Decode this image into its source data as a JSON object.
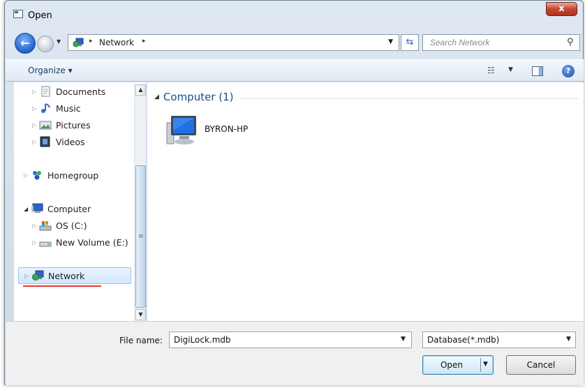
{
  "window": {
    "title": "Open",
    "close_glyph": "x"
  },
  "address": {
    "nav_back_glyph": "←",
    "crumb": "Network",
    "separator": "▸",
    "search_placeholder": "Search Network"
  },
  "toolbar": {
    "organize": "Organize ▾"
  },
  "nav_tree": {
    "items": [
      {
        "label": "Documents",
        "icon": "documents-icon"
      },
      {
        "label": "Music",
        "icon": "music-icon"
      },
      {
        "label": "Pictures",
        "icon": "pictures-icon"
      },
      {
        "label": "Videos",
        "icon": "videos-icon"
      },
      {
        "label": "Homegroup",
        "icon": "homegroup-icon"
      },
      {
        "label": "Computer",
        "icon": "computer-icon"
      },
      {
        "label": "OS (C:)",
        "icon": "drive-c-icon"
      },
      {
        "label": "New Volume (E:)",
        "icon": "drive-e-icon"
      },
      {
        "label": "Network",
        "icon": "network-icon",
        "selected": true
      }
    ]
  },
  "content": {
    "group_title": "Computer (1)",
    "items": [
      {
        "label": "BYRON-HP",
        "icon": "computer-icon"
      }
    ]
  },
  "bottom": {
    "file_name_label": "File name:",
    "file_name_value": "DigiLock.mdb",
    "filter": "Database(*.mdb)",
    "open_label": "Open",
    "cancel_label": "Cancel"
  },
  "colors": {
    "accent": "#1e4b8c",
    "annotation_underline": "#e53a3a",
    "selection": "#d3e6fb"
  }
}
